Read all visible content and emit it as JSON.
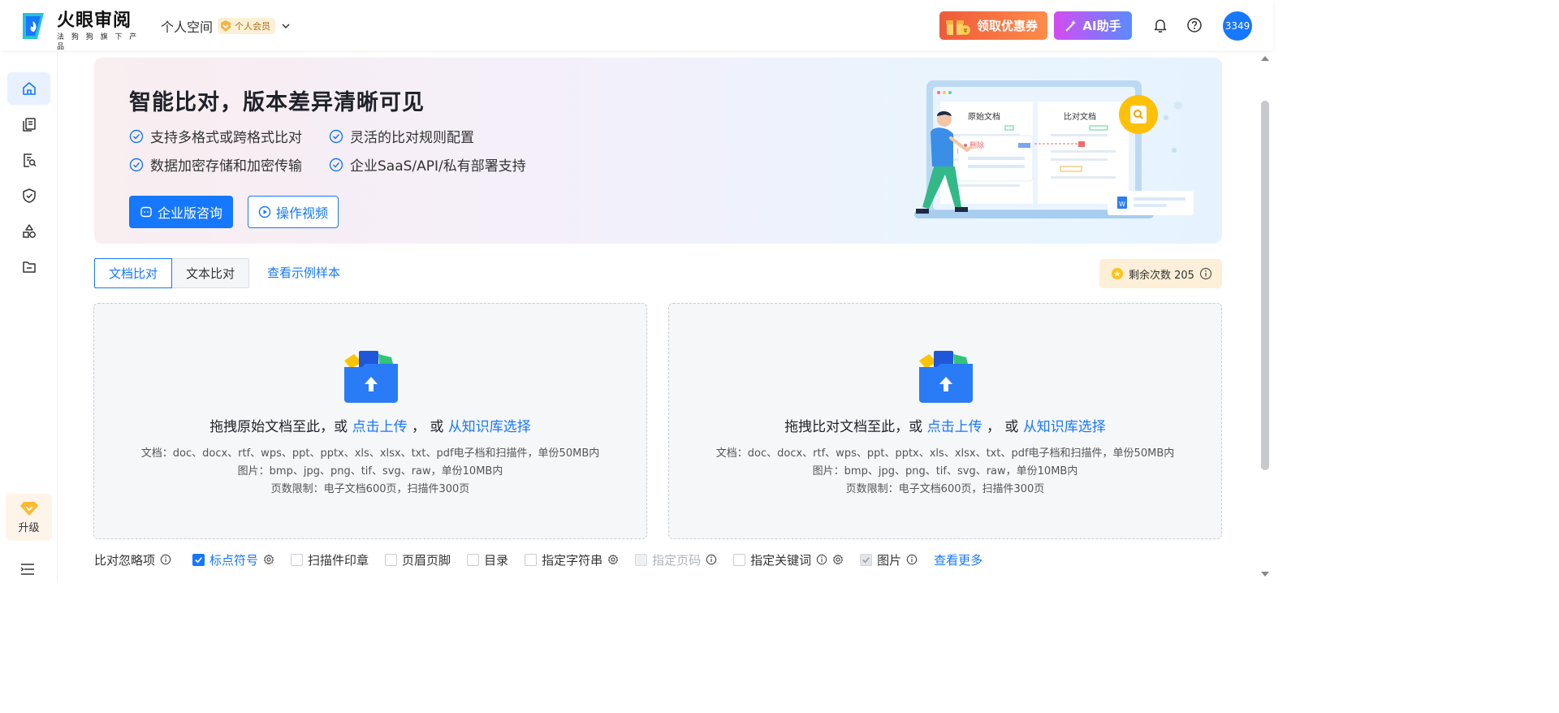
{
  "header": {
    "logo_title": "火眼审阅",
    "logo_subtitle": "法 狗 狗 旗 下 产 品",
    "workspace": "个人空间",
    "member_badge": "个人会员",
    "coupon_label": "领取优惠券",
    "ai_label": "AI助手",
    "avatar_text": "3349"
  },
  "sidebar": {
    "items": [
      {
        "icon": "home-icon",
        "active": true
      },
      {
        "icon": "documents-icon",
        "active": false
      },
      {
        "icon": "document-search-icon",
        "active": false
      },
      {
        "icon": "shield-check-icon",
        "active": false
      },
      {
        "icon": "shapes-icon",
        "active": false
      },
      {
        "icon": "folder-icon",
        "active": false
      }
    ],
    "upgrade_label": "升级"
  },
  "banner": {
    "title": "智能比对，版本差异清晰可见",
    "features": [
      "支持多格式或跨格式比对",
      "灵活的比对规则配置",
      "数据加密存储和加密传输",
      "企业SaaS/API/私有部署支持"
    ],
    "primary_button": "企业版咨询",
    "secondary_button": "操作视频",
    "illus_original": "原始文档",
    "illus_compare": "比对文档",
    "illus_delete": "删除"
  },
  "tabs": {
    "items": [
      "文档比对",
      "文本比对"
    ],
    "active": 0,
    "sample_link": "查看示例样本",
    "remaining_label": "剩余次数 205"
  },
  "upload_left": {
    "prefix": "拖拽原始文档至此，或",
    "click_link": "点击上传",
    "mid": "，  或",
    "kb_link": "从知识库选择",
    "doc_note": "文档：doc、docx、rtf、wps、ppt、pptx、xls、xlsx、txt、pdf电子档和扫描件，单份50MB内",
    "img_note": "图片：bmp、jpg、png、tif、svg、raw，单份10MB内",
    "page_note": "页数限制：电子文档600页，扫描件300页"
  },
  "upload_right": {
    "prefix": "拖拽比对文档至此，或",
    "click_link": "点击上传",
    "mid": "，  或",
    "kb_link": "从知识库选择",
    "doc_note": "文档：doc、docx、rtf、wps、ppt、pptx、xls、xlsx、txt、pdf电子档和扫描件，单份50MB内",
    "img_note": "图片：bmp、jpg、png、tif、svg、raw，单份10MB内",
    "page_note": "页数限制：电子文档600页，扫描件300页"
  },
  "ignore": {
    "label": "比对忽略项",
    "options": [
      {
        "label": "标点符号",
        "checked": true,
        "disabled": false
      },
      {
        "label": "扫描件印章",
        "checked": false,
        "disabled": false
      },
      {
        "label": "页眉页脚",
        "checked": false,
        "disabled": false
      },
      {
        "label": "目录",
        "checked": false,
        "disabled": false
      },
      {
        "label": "指定字符串",
        "checked": false,
        "disabled": false
      },
      {
        "label": "指定页码",
        "checked": false,
        "disabled": true
      },
      {
        "label": "指定关键词",
        "checked": false,
        "disabled": false
      },
      {
        "label": "图片",
        "checked": true,
        "disabled": true
      }
    ],
    "more_link": "查看更多"
  },
  "colors": {
    "primary": "#1677ff",
    "coupon": "#ef5a3a",
    "ai_gradient_start": "#d34cf0",
    "ai_gradient_end": "#5a8bff",
    "remaining_bg": "#fdefd8"
  }
}
